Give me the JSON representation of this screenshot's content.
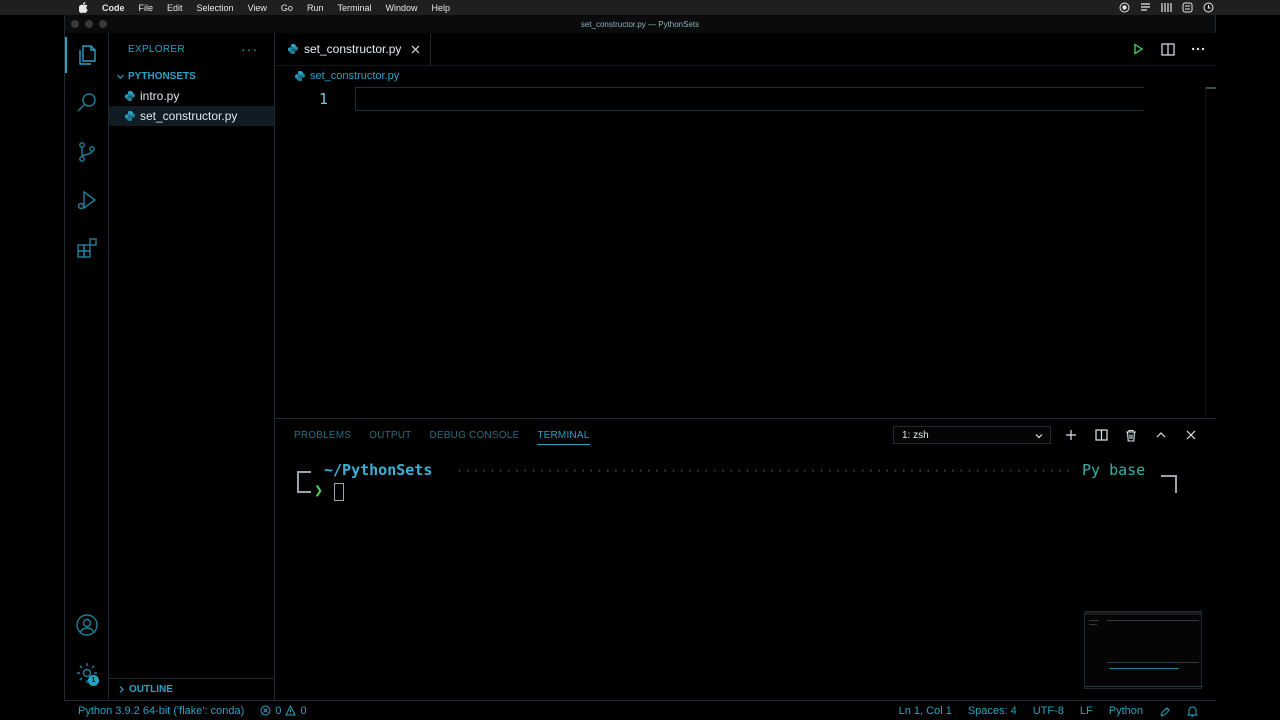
{
  "menubar": {
    "app_name": "Code",
    "items": [
      "File",
      "Edit",
      "Selection",
      "View",
      "Go",
      "Run",
      "Terminal",
      "Window",
      "Help"
    ]
  },
  "window": {
    "title": "set_constructor.py — PythonSets"
  },
  "sidebar": {
    "header": "EXPLORER",
    "more": "···",
    "folder": "PYTHONSETS",
    "files": [
      "intro.py",
      "set_constructor.py"
    ],
    "selected_file": "set_constructor.py",
    "outline": "OUTLINE"
  },
  "editor": {
    "tab_label": "set_constructor.py",
    "breadcrumb": "set_constructor.py",
    "line_number": "1"
  },
  "panel": {
    "tabs": [
      "PROBLEMS",
      "OUTPUT",
      "DEBUG CONSOLE",
      "TERMINAL"
    ],
    "active_tab": "TERMINAL",
    "terminal_select": "1: zsh"
  },
  "terminal": {
    "path": "~/PythonSets",
    "dots": "·······················································································",
    "env": "Py base",
    "prompt": "❯"
  },
  "statusbar": {
    "interpreter": "Python 3.9.2 64-bit ('flake': conda)",
    "errors": "0",
    "warnings": "0",
    "position": "Ln 1, Col 1",
    "spaces": "Spaces: 4",
    "encoding": "UTF-8",
    "eol": "LF",
    "language": "Python"
  },
  "activity": {
    "settings_badge": "1"
  },
  "colors": {
    "accent": "#29a3c4",
    "prompt_green": "#46d84a",
    "env_teal": "#2fb3a7"
  }
}
